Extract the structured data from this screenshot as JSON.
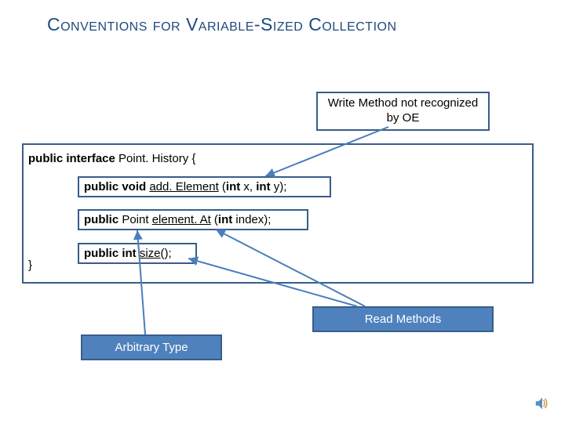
{
  "title": "Conventions for Variable-Sized Collection",
  "callout_write": "Write Method not recognized by OE",
  "iface": {
    "kw_public": "public",
    "kw_interface": "interface",
    "name": "Point. History",
    "open": "{",
    "close": "}"
  },
  "m1": {
    "pre": "public void ",
    "uname": "add. Element",
    "mid": " (",
    "int1": "int",
    "x": " x, ",
    "int2": "int",
    "y": " y);"
  },
  "m2": {
    "pre": "public",
    "mid1": " Point ",
    "uname": "element. At",
    "mid2": " (",
    "int1": "int",
    "tail": " index);"
  },
  "m3": {
    "pre": "public int ",
    "uname": "size",
    "tail": "();"
  },
  "label_arbitrary": "Arbitrary Type",
  "label_read": "Read Methods",
  "colors": {
    "accent": "#4f81bd",
    "accent_dark": "#385d8a",
    "title": "#1f497d"
  },
  "chart_data": {
    "type": "diagram",
    "nodes": [
      {
        "id": "write_note",
        "text": "Write Method not recognized by OE"
      },
      {
        "id": "addElement",
        "text": "public void add.Element (int x, int y);"
      },
      {
        "id": "elementAt",
        "text": "public Point element.At (int index);"
      },
      {
        "id": "size",
        "text": "public int size();"
      },
      {
        "id": "arbitrary",
        "text": "Arbitrary Type"
      },
      {
        "id": "read",
        "text": "Read Methods"
      }
    ],
    "edges": [
      {
        "from": "write_note",
        "to": "addElement"
      },
      {
        "from": "arbitrary",
        "to": "elementAt"
      },
      {
        "from": "read",
        "to": "elementAt"
      },
      {
        "from": "read",
        "to": "size"
      }
    ]
  }
}
